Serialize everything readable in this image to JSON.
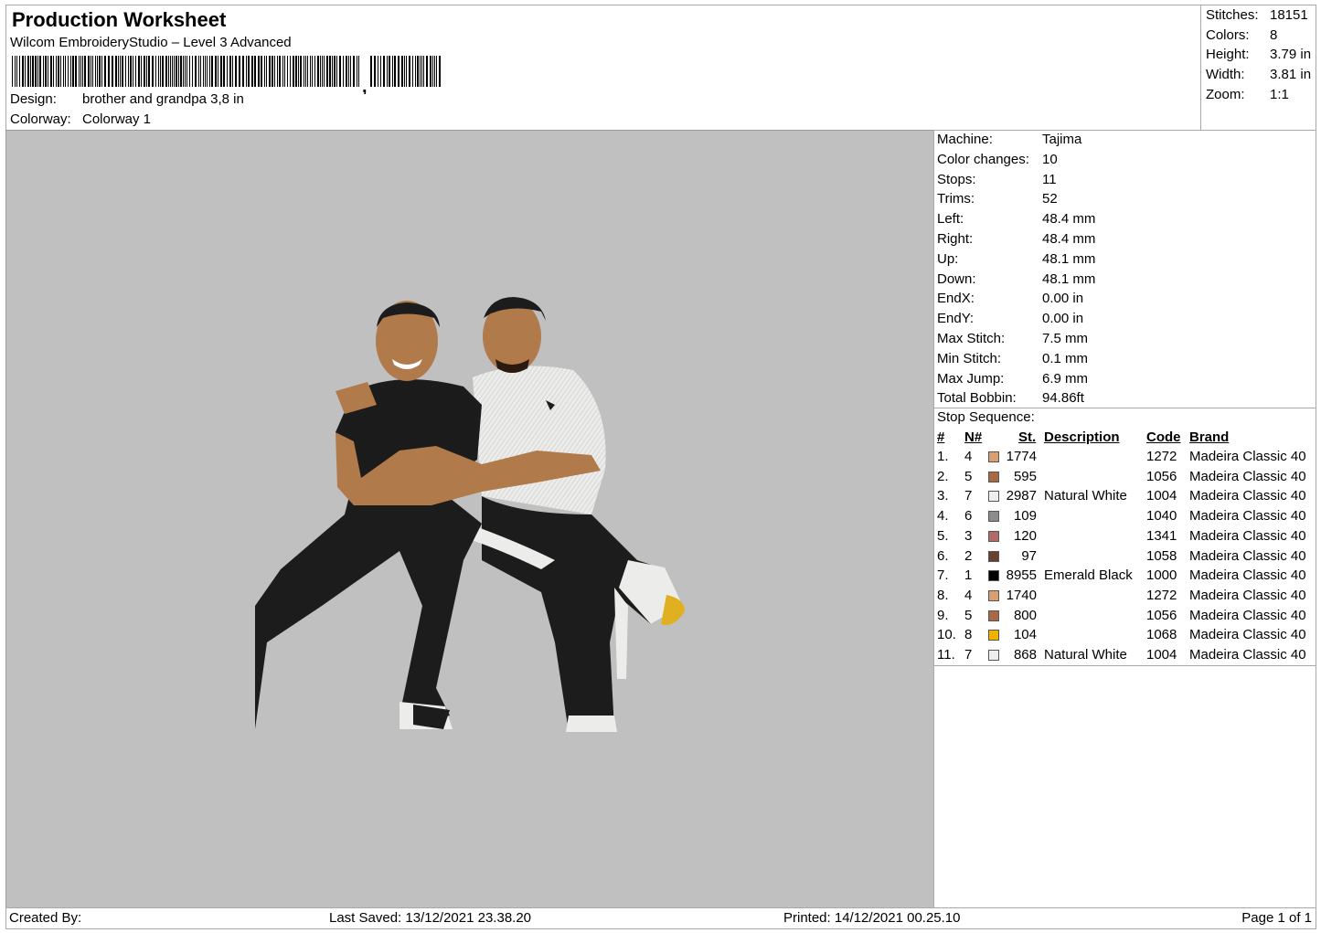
{
  "header": {
    "title": "Production Worksheet",
    "software": "Wilcom EmbroideryStudio – Level 3 Advanced",
    "design_label": "Design:",
    "design_value": "brother and grandpa 3,8 in",
    "colorway_label": "Colorway:",
    "colorway_value": "Colorway 1"
  },
  "summary": [
    {
      "label": "Stitches:",
      "value": "18151"
    },
    {
      "label": "Colors:",
      "value": "8"
    },
    {
      "label": "Height:",
      "value": "3.79 in"
    },
    {
      "label": "Width:",
      "value": "3.81 in"
    },
    {
      "label": "Zoom:",
      "value": "1:1"
    }
  ],
  "machine": [
    {
      "label": "Machine:",
      "value": "Tajima"
    },
    {
      "label": "Color changes:",
      "value": "10"
    },
    {
      "label": "Stops:",
      "value": "11"
    },
    {
      "label": "Trims:",
      "value": "52"
    },
    {
      "label": "Left:",
      "value": "48.4 mm"
    },
    {
      "label": "Right:",
      "value": "48.4 mm"
    },
    {
      "label": "Up:",
      "value": "48.1 mm"
    },
    {
      "label": "Down:",
      "value": "48.1 mm"
    },
    {
      "label": "EndX:",
      "value": "0.00 in"
    },
    {
      "label": "EndY:",
      "value": "0.00 in"
    },
    {
      "label": "Max Stitch:",
      "value": "7.5 mm"
    },
    {
      "label": "Min Stitch:",
      "value": "0.1 mm"
    },
    {
      "label": "Max Jump:",
      "value": "6.9 mm"
    },
    {
      "label": "Total Bobbin:",
      "value": "94.86ft"
    }
  ],
  "stop_sequence": {
    "title": "Stop Sequence:",
    "headers": {
      "idx": "#",
      "n": "N#",
      "st": "St.",
      "desc": "Description",
      "code": "Code",
      "brand": "Brand"
    },
    "rows": [
      {
        "idx": "1.",
        "n": "4",
        "color": "#d8a070",
        "st": "1774",
        "desc": "",
        "code": "1272",
        "brand": "Madeira Classic 40"
      },
      {
        "idx": "2.",
        "n": "5",
        "color": "#a86a45",
        "st": "595",
        "desc": "",
        "code": "1056",
        "brand": "Madeira Classic 40"
      },
      {
        "idx": "3.",
        "n": "7",
        "color": "#eeeef0",
        "st": "2987",
        "desc": "Natural White",
        "code": "1004",
        "brand": "Madeira Classic 40"
      },
      {
        "idx": "4.",
        "n": "6",
        "color": "#8c8c8c",
        "st": "109",
        "desc": "",
        "code": "1040",
        "brand": "Madeira Classic 40"
      },
      {
        "idx": "5.",
        "n": "3",
        "color": "#b06a68",
        "st": "120",
        "desc": "",
        "code": "1341",
        "brand": "Madeira Classic 40"
      },
      {
        "idx": "6.",
        "n": "2",
        "color": "#6a4030",
        "st": "97",
        "desc": "",
        "code": "1058",
        "brand": "Madeira Classic 40"
      },
      {
        "idx": "7.",
        "n": "1",
        "color": "#000000",
        "st": "8955",
        "desc": "Emerald Black",
        "code": "1000",
        "brand": "Madeira Classic 40"
      },
      {
        "idx": "8.",
        "n": "4",
        "color": "#d8a070",
        "st": "1740",
        "desc": "",
        "code": "1272",
        "brand": "Madeira Classic 40"
      },
      {
        "idx": "9.",
        "n": "5",
        "color": "#a86a45",
        "st": "800",
        "desc": "",
        "code": "1056",
        "brand": "Madeira Classic 40"
      },
      {
        "idx": "10.",
        "n": "8",
        "color": "#f0b400",
        "st": "104",
        "desc": "",
        "code": "1068",
        "brand": "Madeira Classic 40"
      },
      {
        "idx": "11.",
        "n": "7",
        "color": "#eeeef0",
        "st": "868",
        "desc": "Natural White",
        "code": "1004",
        "brand": "Madeira Classic 40"
      }
    ]
  },
  "footer": {
    "created_by": "Created By:",
    "last_saved": "Last Saved: 13/12/2021 23.38.20",
    "printed": "Printed: 14/12/2021 00.25.10",
    "page": "Page 1 of 1"
  },
  "colors": {
    "preview_background": "#c0c0c0",
    "skin": "#b07a4a",
    "black": "#1c1c1c",
    "white": "#ececea",
    "yellow": "#e0b020"
  }
}
